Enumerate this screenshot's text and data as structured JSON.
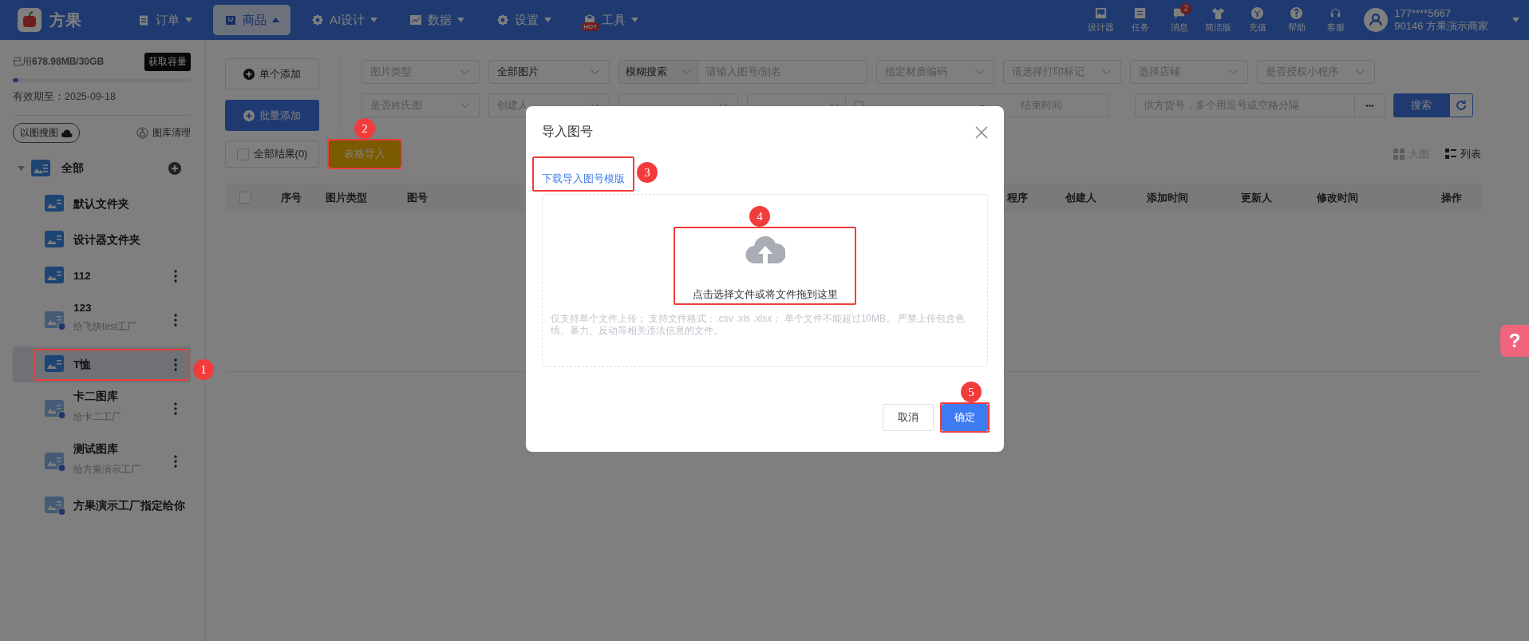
{
  "header": {
    "logo": "方果",
    "nav": [
      {
        "label": "订单",
        "selected": false
      },
      {
        "label": "商品",
        "selected": true
      },
      {
        "label": "AI设计",
        "selected": false
      },
      {
        "label": "数据",
        "selected": false
      },
      {
        "label": "设置",
        "selected": false
      },
      {
        "label": "工具",
        "selected": false,
        "badge": "HOT"
      }
    ],
    "tools": [
      {
        "label": "设计器"
      },
      {
        "label": "任务"
      },
      {
        "label": "消息",
        "badge": "2"
      },
      {
        "label": "简洁版"
      },
      {
        "label": "充值"
      },
      {
        "label": "帮助"
      },
      {
        "label": "客服"
      }
    ],
    "user": {
      "phone": "177****5667",
      "name": "90146 方果演示商家"
    }
  },
  "sidebar": {
    "storage": {
      "text": "已用**678.98MB/30GB**",
      "level": 0.02
    },
    "capacity_button": "获取容量",
    "expiry": "有效期至：2025-09-18",
    "search_by_image": "以图搜图",
    "cleanup": "图库清理",
    "tree": [
      {
        "label": "全部",
        "expanded": true,
        "children": [
          {
            "label": "默认文件夹",
            "shared": false,
            "menu": false,
            "selected": false
          },
          {
            "label": "设计器文件夹",
            "shared": false,
            "menu": false,
            "selected": false
          },
          {
            "label": "112",
            "shared": false,
            "menu": true,
            "selected": false
          },
          {
            "label": "123",
            "shared": true,
            "subtitle": "给飞快test工厂",
            "menu": true,
            "selected": false
          },
          {
            "label": "T恤",
            "shared": false,
            "menu": true,
            "selected": true
          },
          {
            "label": "卡二图库",
            "shared": true,
            "subtitle": "给卡二工厂",
            "menu": true,
            "selected": false
          },
          {
            "label": "测试图库",
            "shared": true,
            "subtitle": "给方果演示工厂",
            "menu": true,
            "selected": false
          },
          {
            "label": "方果演示工厂指定给你",
            "shared": true,
            "menu": false,
            "selected": false
          }
        ]
      }
    ]
  },
  "toolbar": {
    "add_single": "单个添加",
    "add_batch": "批量添加",
    "row1": [
      {
        "kind": "select",
        "placeholder": "图片类型"
      },
      {
        "kind": "select",
        "value": "全部图片"
      },
      {
        "kind": "search",
        "mode": "模糊搜索",
        "placeholder": "请输入图号/别名"
      },
      {
        "kind": "select",
        "placeholder": "指定材质编码"
      },
      {
        "kind": "select",
        "placeholder": "请选择打印标记"
      },
      {
        "kind": "select",
        "placeholder": "选择店铺"
      },
      {
        "kind": "select",
        "placeholder": "是否授权小程序"
      }
    ],
    "row2": [
      {
        "kind": "select",
        "placeholder": "是否姓氏图"
      },
      {
        "kind": "select",
        "placeholder": "创建人"
      },
      {
        "kind": "select"
      },
      {
        "kind": "daterange",
        "end": "结束时间"
      },
      {
        "kind": "text",
        "placeholder": "供方货号，多个用逗号或空格分隔",
        "more": "•••"
      }
    ],
    "search_button": "搜索",
    "all_results": {
      "label": "全部结果(0)",
      "checked": false
    },
    "import_button": "表格导入",
    "views": [
      {
        "label": "大图",
        "selected": false
      },
      {
        "label": "列表",
        "selected": true
      }
    ]
  },
  "table": {
    "all_checked": false,
    "columns": [
      "序号",
      "图片类型",
      "图号",
      "程序",
      "创建人",
      "添加时间",
      "更新人",
      "修改时间",
      "操作"
    ]
  },
  "modal": {
    "title": "导入图号",
    "template_link": "下载导入图号模版",
    "dropzone_text": "点击选择文件或将文件拖到这里",
    "hint": "仅支持单个文件上传； 支持文件格式：.csv .xls .xlsx； 单个文件不能超过10MB。 严禁上传包含色情、暴力、反动等相关违法信息的文件。",
    "cancel": "取消",
    "confirm": "确定"
  },
  "annotations": [
    {
      "number": "1"
    },
    {
      "number": "2"
    },
    {
      "number": "3"
    },
    {
      "number": "4"
    },
    {
      "number": "5"
    }
  ],
  "help_tab": "?"
}
